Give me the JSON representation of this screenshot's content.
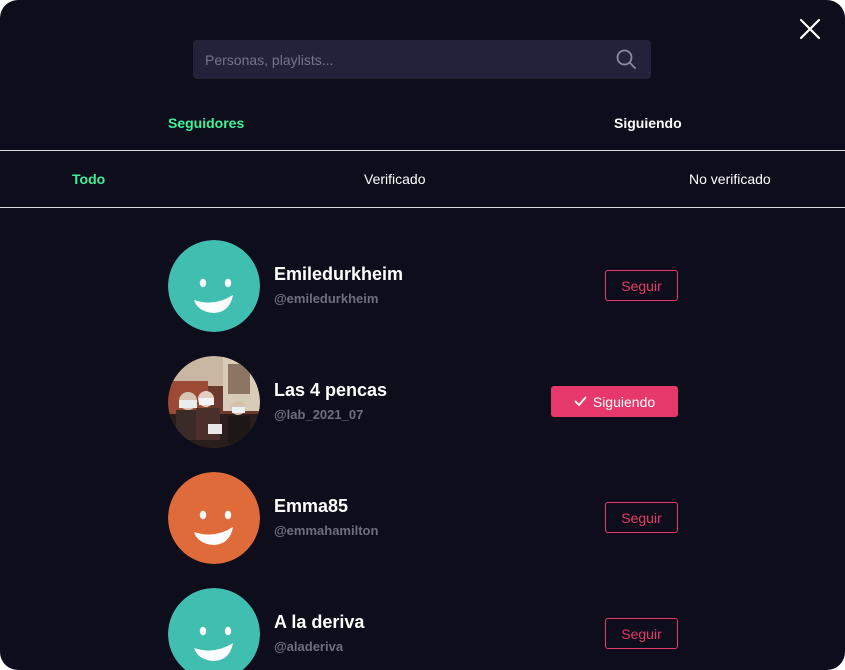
{
  "search": {
    "placeholder": "Personas, playlists..."
  },
  "tabs": [
    {
      "label": "Seguidores",
      "active": true
    },
    {
      "label": "Siguiendo",
      "active": false
    }
  ],
  "filters": [
    {
      "label": "Todo",
      "active": true
    },
    {
      "label": "Verificado",
      "active": false
    },
    {
      "label": "No verificado",
      "active": false
    }
  ],
  "users": [
    {
      "name": "Emiledurkheim",
      "handle": "@emiledurkheim",
      "avatar": "smiley-avatar",
      "avatar_color": "#40bfb0",
      "button_label": "Seguir",
      "following": false
    },
    {
      "name": "Las 4 pencas",
      "handle": "@lab_2021_07",
      "avatar": "photo-avatar",
      "button_label": "Siguiendo",
      "following": true
    },
    {
      "name": "Emma85",
      "handle": "@emmahamilton",
      "avatar": "smiley-avatar",
      "avatar_color": "#e06b3a",
      "button_label": "Seguir",
      "following": false
    },
    {
      "name": "A la deriva",
      "handle": "@aladeriva",
      "avatar": "smiley-avatar",
      "avatar_color": "#40bfb0",
      "button_label": "Seguir",
      "following": false
    }
  ],
  "colors": {
    "background": "#0e0d1b",
    "accent_green": "#3df29a",
    "accent_pink": "#e6386a",
    "search_bg": "#22223a",
    "handle_text": "#6e6e80"
  },
  "icons": [
    "close-icon",
    "search-icon",
    "check-icon"
  ]
}
